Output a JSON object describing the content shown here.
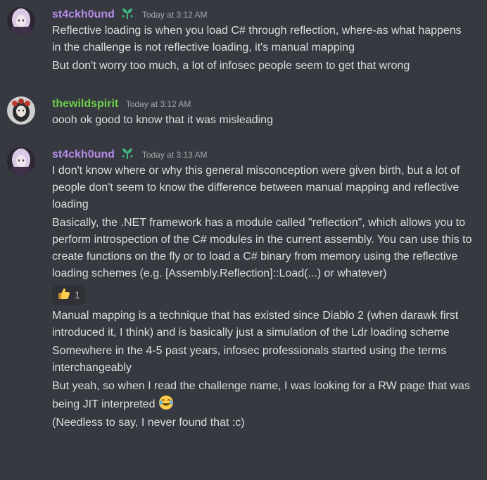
{
  "messages": [
    {
      "author": "st4ckh0und",
      "timestamp": "Today at 3:12 AM",
      "lines": [
        "Reflective loading is when you load C# through reflection, where-as what happens in the challenge is not reflective loading, it's manual mapping",
        "But don't worry too much, a lot of infosec people seem to get that wrong"
      ]
    },
    {
      "author": "thewildspirit",
      "timestamp": "Today at 3:12 AM",
      "lines": [
        "oooh ok good to know that it was misleading"
      ]
    },
    {
      "author": "st4ckh0und",
      "timestamp": "Today at 3:13 AM",
      "lines": [
        "I don't know where or why this general misconception were given birth, but a lot of people don't seem to know the difference between manual mapping and reflective loading",
        "Basically, the .NET framework has a module called \"reflection\", which allows you to perform introspection of the C# modules in the current assembly. You can use this to create functions on the fly or to load a C# binary from memory using the reflective loading schemes (e.g. [Assembly.Reflection]::Load(...) or whatever)"
      ],
      "reaction": {
        "emoji": "thumbs-up",
        "count": "1"
      },
      "lines_after": [
        "Manual mapping is a technique that has existed since Diablo 2 (when darawk first introduced it, I think) and is basically just a simulation of the Ldr loading scheme",
        "Somewhere in the 4-5 past years, infosec professionals started using the terms interchangeably",
        "But yeah, so when I read the challenge name, I was looking for a RW page that was being JIT interpreted",
        "(Needless to say, I never found that :c)"
      ]
    }
  ],
  "colors": {
    "background": "#36393f",
    "text": "#dcddde",
    "timestamp": "#a3a6aa",
    "author_st4ckh0und": "#b58be6",
    "author_thewildspirit": "#6fd04a",
    "reaction_bg": "#2f3136"
  },
  "icons": {
    "badge": "sprout-icon",
    "reaction": "thumbs-up-icon",
    "inline_emoji": "joy-emoji"
  }
}
